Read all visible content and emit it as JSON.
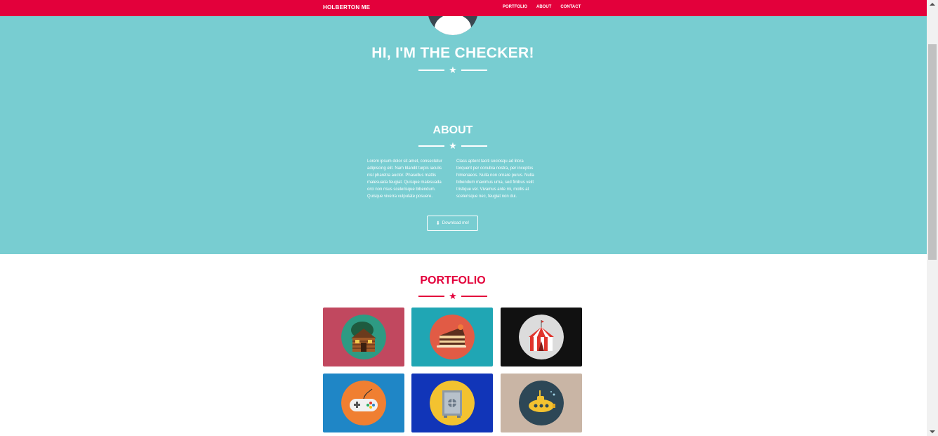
{
  "nav": {
    "brand": "HOLBERTON ME",
    "links": [
      "PORTFOLIO",
      "ABOUT",
      "CONTACT"
    ]
  },
  "hero": {
    "title": "HI, I'M THE CHECKER!"
  },
  "about": {
    "title": "ABOUT",
    "col_left": "Lorem ipsum dolor sit amet, consectetur adipiscing elit. Nam blandit turpis iaculis nisl pharetra auctor. Phasellus mattis malesuada feugiat. Quisque malesuada orci non risus scelerisque bibendum. Quisque viverra vulputate posuere.",
    "col_right": "Class aptent taciti sociosqu ad litora torquent per conubia nostra, per inceptos himenaeos. Nulla non ornare purus. Nulla bibendum maximus urna, sed finibus velit tristique vel. Vivamus ante mi, mollis at scelerisque nec, feugiat non dui.",
    "download_label": "Download me!"
  },
  "portfolio": {
    "title": "PORTFOLIO",
    "tiles": [
      {
        "name": "cabin",
        "bg": "#c1485f",
        "circle": "#2e9a83"
      },
      {
        "name": "cake",
        "bg": "#20a6b4",
        "circle": "#e15b45"
      },
      {
        "name": "circus",
        "bg": "#111111",
        "circle": "#dcdcdc"
      },
      {
        "name": "game-controller",
        "bg": "#1f86c6",
        "circle": "#f07f31"
      },
      {
        "name": "safe",
        "bg": "#1135b8",
        "circle": "#f3c230"
      },
      {
        "name": "submarine",
        "bg": "#c9b5a5",
        "circle": "#2d4756"
      }
    ]
  },
  "colors": {
    "accent": "#e3003b",
    "hero_bg": "#78cdd1"
  }
}
